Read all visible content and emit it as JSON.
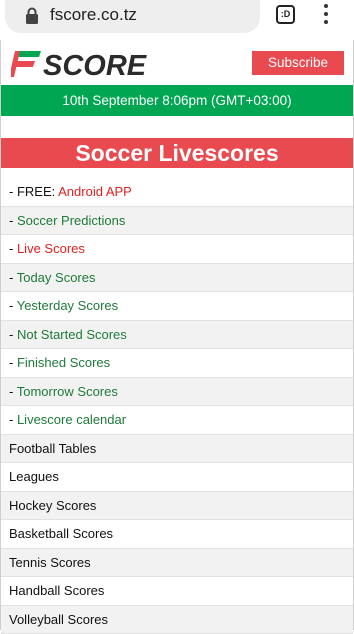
{
  "browser": {
    "url": "fscore.co.tz",
    "tab_label": ":D"
  },
  "header": {
    "logo_text": "FSCORE",
    "subscribe_label": "Subscribe"
  },
  "date_bar": "10th September 8:06pm (GMT+03:00)",
  "title": "Soccer Livescores",
  "menu": [
    {
      "prefix": "- FREE: ",
      "label": "Android APP",
      "color": "red"
    },
    {
      "prefix": "- ",
      "label": "Soccer Predictions",
      "color": "green"
    },
    {
      "prefix": "- ",
      "label": "Live Scores",
      "color": "red"
    },
    {
      "prefix": "- ",
      "label": "Today Scores",
      "color": "green"
    },
    {
      "prefix": "- ",
      "label": "Yesterday Scores",
      "color": "green"
    },
    {
      "prefix": "- ",
      "label": "Not Started Scores",
      "color": "green"
    },
    {
      "prefix": "- ",
      "label": "Finished Scores",
      "color": "green"
    },
    {
      "prefix": "- ",
      "label": "Tomorrow Scores",
      "color": "green"
    },
    {
      "prefix": "- ",
      "label": "Livescore calendar",
      "color": "green"
    },
    {
      "prefix": "",
      "label": "Football Tables",
      "color": "dark"
    },
    {
      "prefix": "",
      "label": "Leagues",
      "color": "dark"
    },
    {
      "prefix": "",
      "label": "Hockey Scores",
      "color": "dark"
    },
    {
      "prefix": "",
      "label": "Basketball Scores",
      "color": "dark"
    },
    {
      "prefix": "",
      "label": "Tennis Scores",
      "color": "dark"
    },
    {
      "prefix": "",
      "label": "Handball Scores",
      "color": "dark"
    },
    {
      "prefix": "",
      "label": "Volleyball Scores",
      "color": "dark"
    }
  ],
  "colors": {
    "brand_green": "#00a651",
    "brand_red": "#e84a4f",
    "link_green": "#1f7a3a",
    "link_red": "#e02020"
  }
}
